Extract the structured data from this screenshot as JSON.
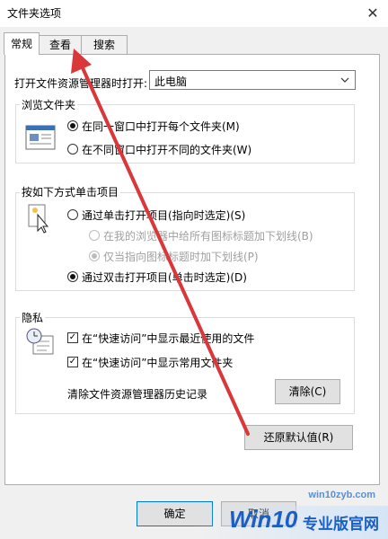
{
  "window": {
    "title": "文件夹选项"
  },
  "tabs": [
    "常规",
    "查看",
    "搜索"
  ],
  "explorer_open": {
    "label": "打开文件资源管理器时打开:",
    "value": "此电脑"
  },
  "browse_folders": {
    "title": "浏览文件夹",
    "options": [
      "在同一窗口中打开每个文件夹(M)",
      "在不同窗口中打开不同的文件夹(W)"
    ],
    "selected": 0
  },
  "click_items": {
    "title": "按如下方式单击项目",
    "single_click": "通过单击打开项目(指向时选定)(S)",
    "sub_options": [
      "在我的浏览器中给所有图标标题加下划线(B)",
      "仅当指向图标标题时加下划线(P)"
    ],
    "double_click": "通过双击打开项目(单击时选定)(D)",
    "selected": "double_click"
  },
  "privacy": {
    "title": "隐私",
    "checkboxes": [
      "在“快速访问”中显示最近使用的文件",
      "在“快速访问”中显示常用文件夹"
    ],
    "clear_label": "清除文件资源管理器历史记录",
    "clear_button": "清除(C)"
  },
  "restore_button": "还原默认值(R)",
  "footer": {
    "ok": "确定",
    "cancel": "取消"
  },
  "watermark": {
    "brand": "Win10",
    "brand_suffix": "专业版官网",
    "url": "win10zyb.com"
  },
  "colors": {
    "arrow": "#d9373a",
    "dialog_bg": "#f0f0f0",
    "accent": "#0078d7"
  }
}
